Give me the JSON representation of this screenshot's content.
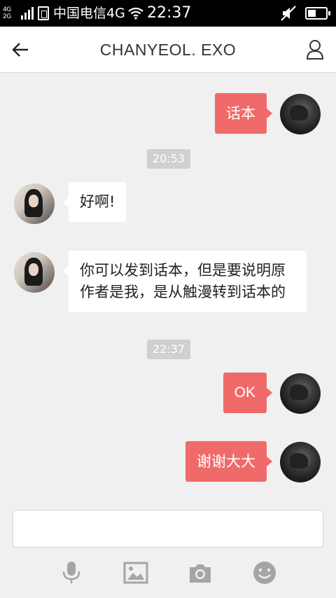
{
  "status_bar": {
    "network_top": "4G",
    "network_bottom": "2G",
    "carrier": "中国电信4G",
    "time": "22:37",
    "battery_level": 0.45
  },
  "header": {
    "title": "CHANYEOL. EXO"
  },
  "messages": [
    {
      "side": "right",
      "text": "话本"
    },
    {
      "side": "time",
      "text": "20:53"
    },
    {
      "side": "left",
      "text": "好啊!"
    },
    {
      "side": "left",
      "text": "你可以发到话本，但是要说明原作者是我，是从触漫转到话本的"
    },
    {
      "side": "time",
      "text": "22:37"
    },
    {
      "side": "right",
      "text": "OK"
    },
    {
      "side": "right",
      "text": "谢谢大大"
    }
  ],
  "composer": {
    "value": "",
    "toolbar": [
      "microphone-icon",
      "image-icon",
      "camera-icon",
      "emoji-icon"
    ]
  },
  "colors": {
    "outgoing_bubble": "#f06a6a",
    "incoming_bubble": "#ffffff",
    "background": "#f0f0f0",
    "icon_gray": "#a5a5a5"
  }
}
